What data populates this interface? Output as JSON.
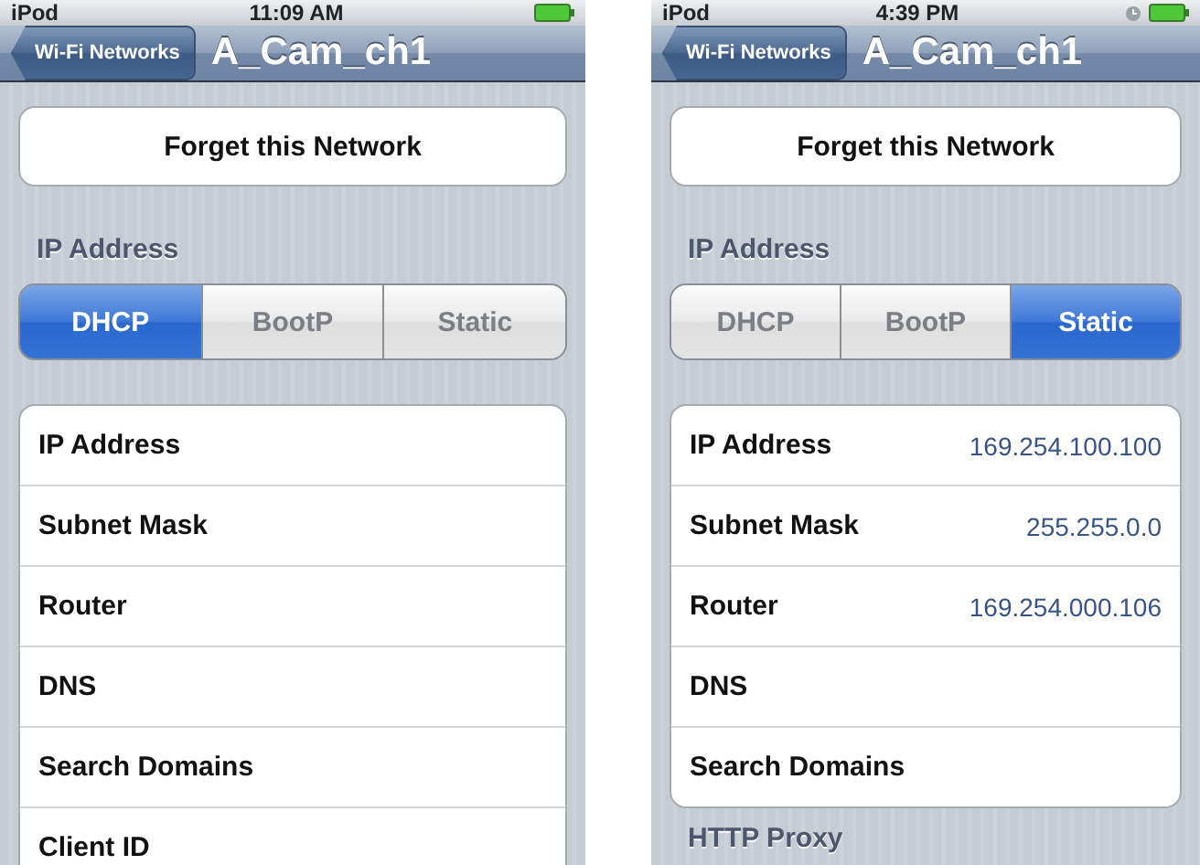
{
  "screens": [
    {
      "status_bar": {
        "carrier": "iPod",
        "time": "11:09 AM",
        "alarm": false
      },
      "nav_bar": {
        "back": "Wi-Fi Networks",
        "title": "A_Cam_ch1"
      },
      "forget_button": "Forget this Network",
      "section_header": "IP Address",
      "segments": [
        {
          "label": "DHCP",
          "selected": true
        },
        {
          "label": "BootP",
          "selected": false
        },
        {
          "label": "Static",
          "selected": false
        }
      ],
      "fields": [
        {
          "label": "IP Address"
        },
        {
          "label": "Subnet Mask"
        },
        {
          "label": "Router"
        },
        {
          "label": "DNS"
        },
        {
          "label": "Search Domains"
        },
        {
          "label": "Client ID"
        }
      ]
    },
    {
      "status_bar": {
        "carrier": "iPod",
        "time": "4:39 PM",
        "alarm": true
      },
      "nav_bar": {
        "back": "Wi-Fi Networks",
        "title": "A_Cam_ch1"
      },
      "forget_button": "Forget this Network",
      "section_header": "IP Address",
      "segments": [
        {
          "label": "DHCP",
          "selected": false
        },
        {
          "label": "BootP",
          "selected": false
        },
        {
          "label": "Static",
          "selected": true
        }
      ],
      "fields": [
        {
          "label": "IP Address",
          "value": "169.254.100.100"
        },
        {
          "label": "Subnet Mask",
          "value": "255.255.0.0"
        },
        {
          "label": "Router",
          "value": "169.254.000.106"
        },
        {
          "label": "DNS"
        },
        {
          "label": "Search Domains"
        }
      ],
      "next_section_header": "HTTP Proxy"
    }
  ]
}
